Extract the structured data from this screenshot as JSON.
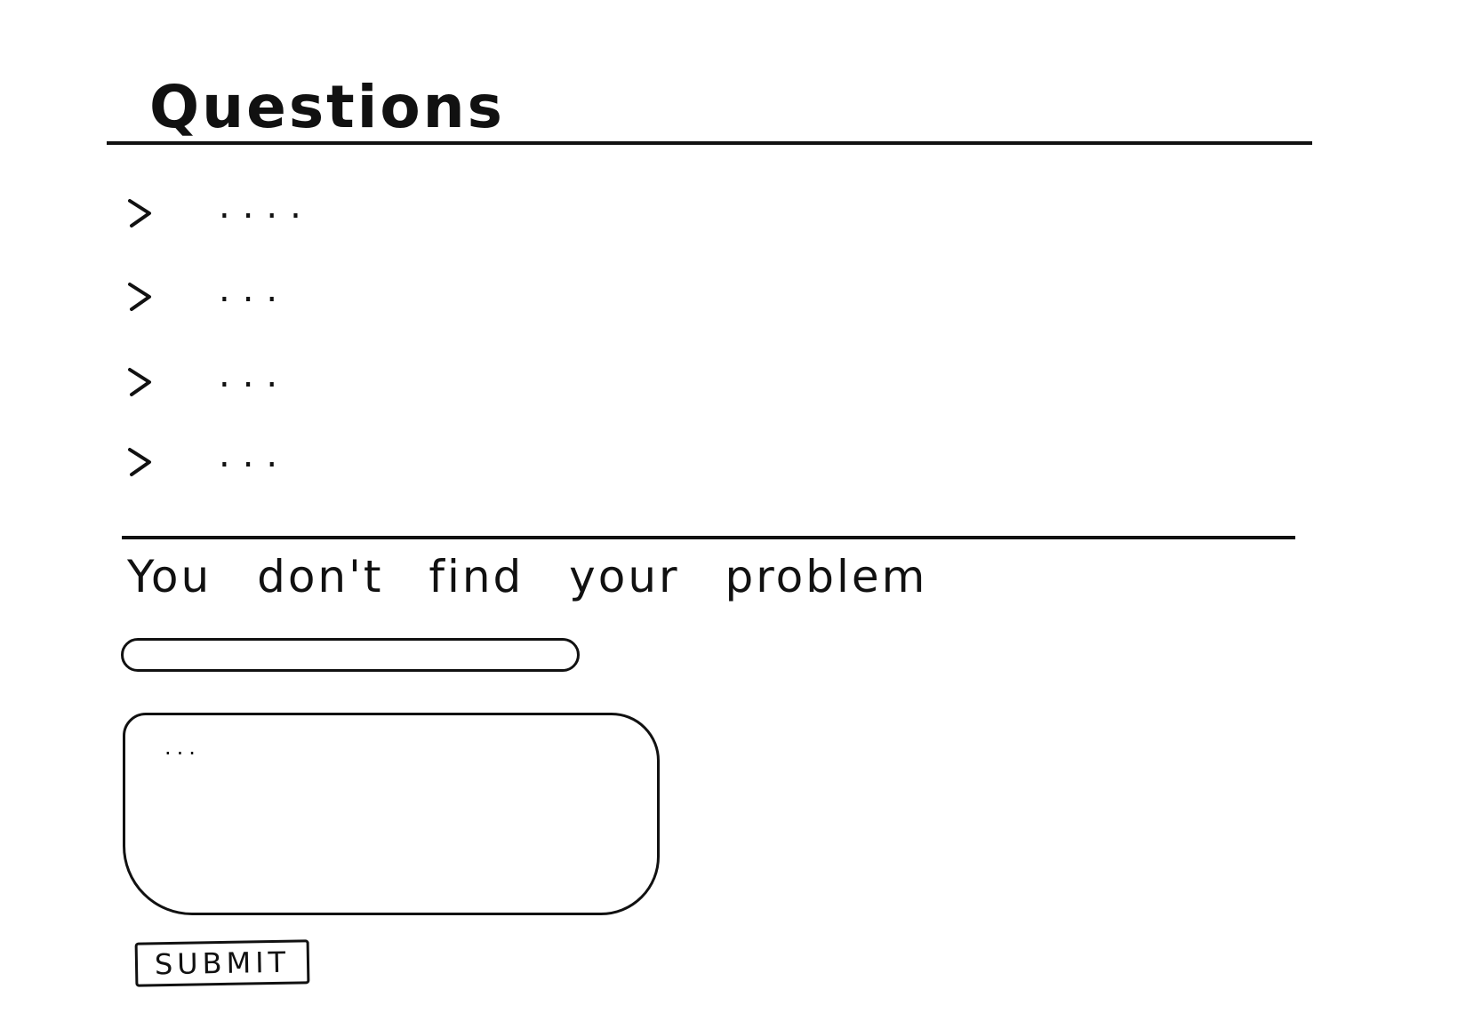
{
  "page": {
    "title": "Questions"
  },
  "faq": {
    "items": [
      {
        "question": "....",
        "icon": "chevron-right-icon"
      },
      {
        "question": "...",
        "icon": "chevron-right-icon"
      },
      {
        "question": "...",
        "icon": "chevron-right-icon"
      },
      {
        "question": "...",
        "icon": "chevron-right-icon"
      }
    ]
  },
  "contact": {
    "heading": "You don't find your problem",
    "subject_input": {
      "value": "",
      "placeholder": ""
    },
    "message_textarea": {
      "value": "",
      "placeholder": "..."
    },
    "submit_label": "SUBMIT"
  }
}
